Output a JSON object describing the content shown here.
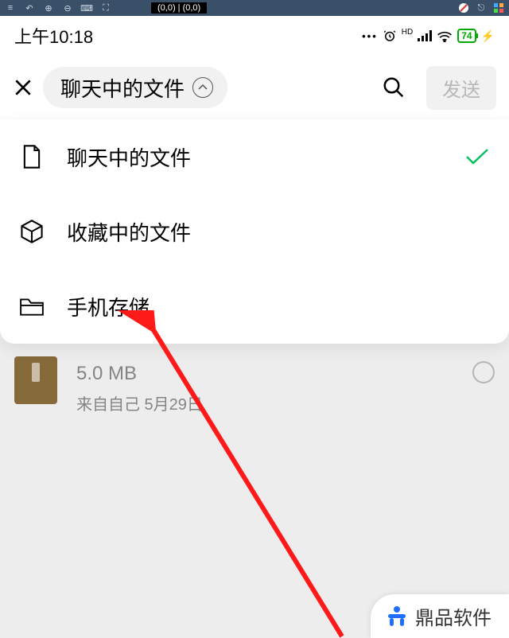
{
  "emulator": {
    "coords": "(0,0) | (0,0)"
  },
  "status": {
    "time": "上午10:18",
    "hd": "HD",
    "battery": "74"
  },
  "header": {
    "pill_label": "聊天中的文件",
    "send_label": "发送"
  },
  "dropdown": {
    "items": [
      {
        "label": "聊天中的文件",
        "selected": true
      },
      {
        "label": "收藏中的文件",
        "selected": false
      },
      {
        "label": "手机存储",
        "selected": false
      }
    ]
  },
  "file": {
    "size": "5.0 MB",
    "meta": "来自自己  5月29日"
  },
  "watermark": {
    "text": "鼎品软件"
  }
}
